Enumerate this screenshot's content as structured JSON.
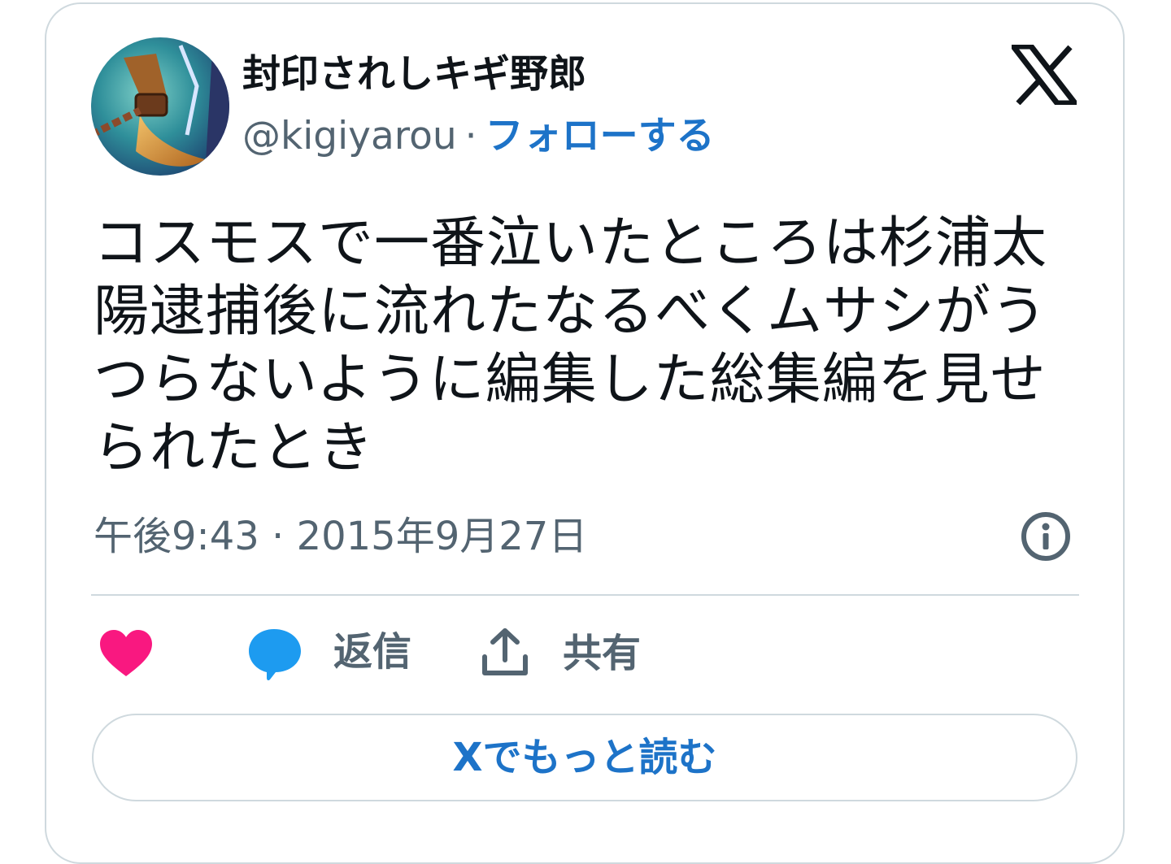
{
  "user": {
    "display_name": "封印されしキギ野郎",
    "handle": "@kigiyarou",
    "separator": "·",
    "follow_label": "フォローする"
  },
  "tweet": {
    "text": "コスモスで一番泣いたところは杉浦太陽逮捕後に流れたなるべくムサシがうつらないように編集した総集編を見せられたとき",
    "timestamp": "午後9:43 · 2015年9月27日"
  },
  "actions": {
    "reply_label": "返信",
    "share_label": "共有"
  },
  "read_more_label": "Xでもっと読む",
  "icons": {
    "brand": "x-logo-icon",
    "info": "info-icon",
    "like": "heart-icon",
    "reply": "speech-bubble-icon",
    "share": "share-upload-icon"
  },
  "colors": {
    "link_blue": "#1d73c8",
    "heart_pink": "#f91880",
    "reply_blue": "#1d9bf0",
    "muted_gray": "#536471",
    "border": "#cfd9de"
  }
}
